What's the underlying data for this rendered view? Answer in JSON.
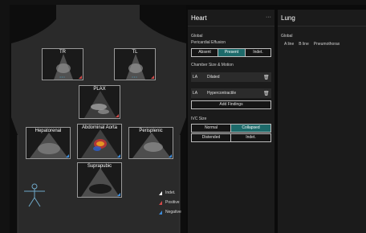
{
  "views": {
    "tr": "TR",
    "tl": "TL",
    "plax": "PLAX",
    "hepatorenal": "Hepatorenal",
    "abdominal_aorta": "Abdominal Aorta",
    "perisplenic": "Perisplenic",
    "suprapubic": "Suprapubic"
  },
  "legend": {
    "indet": "Indet.",
    "positive": "Positive",
    "negative": "Negative"
  },
  "colors": {
    "positive": "#d24a4a",
    "negative": "#3d8bd9",
    "selected": "#1d6a6a"
  },
  "heart": {
    "title": "Heart",
    "more": "···",
    "global_label": "Global",
    "pericardial_label": "Pericardial Effusion",
    "pericardial_options": [
      "Absent",
      "Present",
      "Indet."
    ],
    "pericardial_selected": "Present",
    "chamber_label": "Chamber Size & Motion",
    "findings": [
      {
        "code": "LA",
        "text": "Dilated"
      },
      {
        "code": "LA",
        "text": "Hypercontractile"
      }
    ],
    "add_findings": "Add Findings",
    "ivc_label": "IVC Size",
    "ivc_options": [
      "Normal",
      "Collapsed",
      "Distended",
      "Indet."
    ],
    "ivc_selected": "Collapsed"
  },
  "lung": {
    "title": "Lung",
    "global_label": "Global",
    "items": [
      "A line",
      "B line",
      "Pneumothorax"
    ]
  }
}
